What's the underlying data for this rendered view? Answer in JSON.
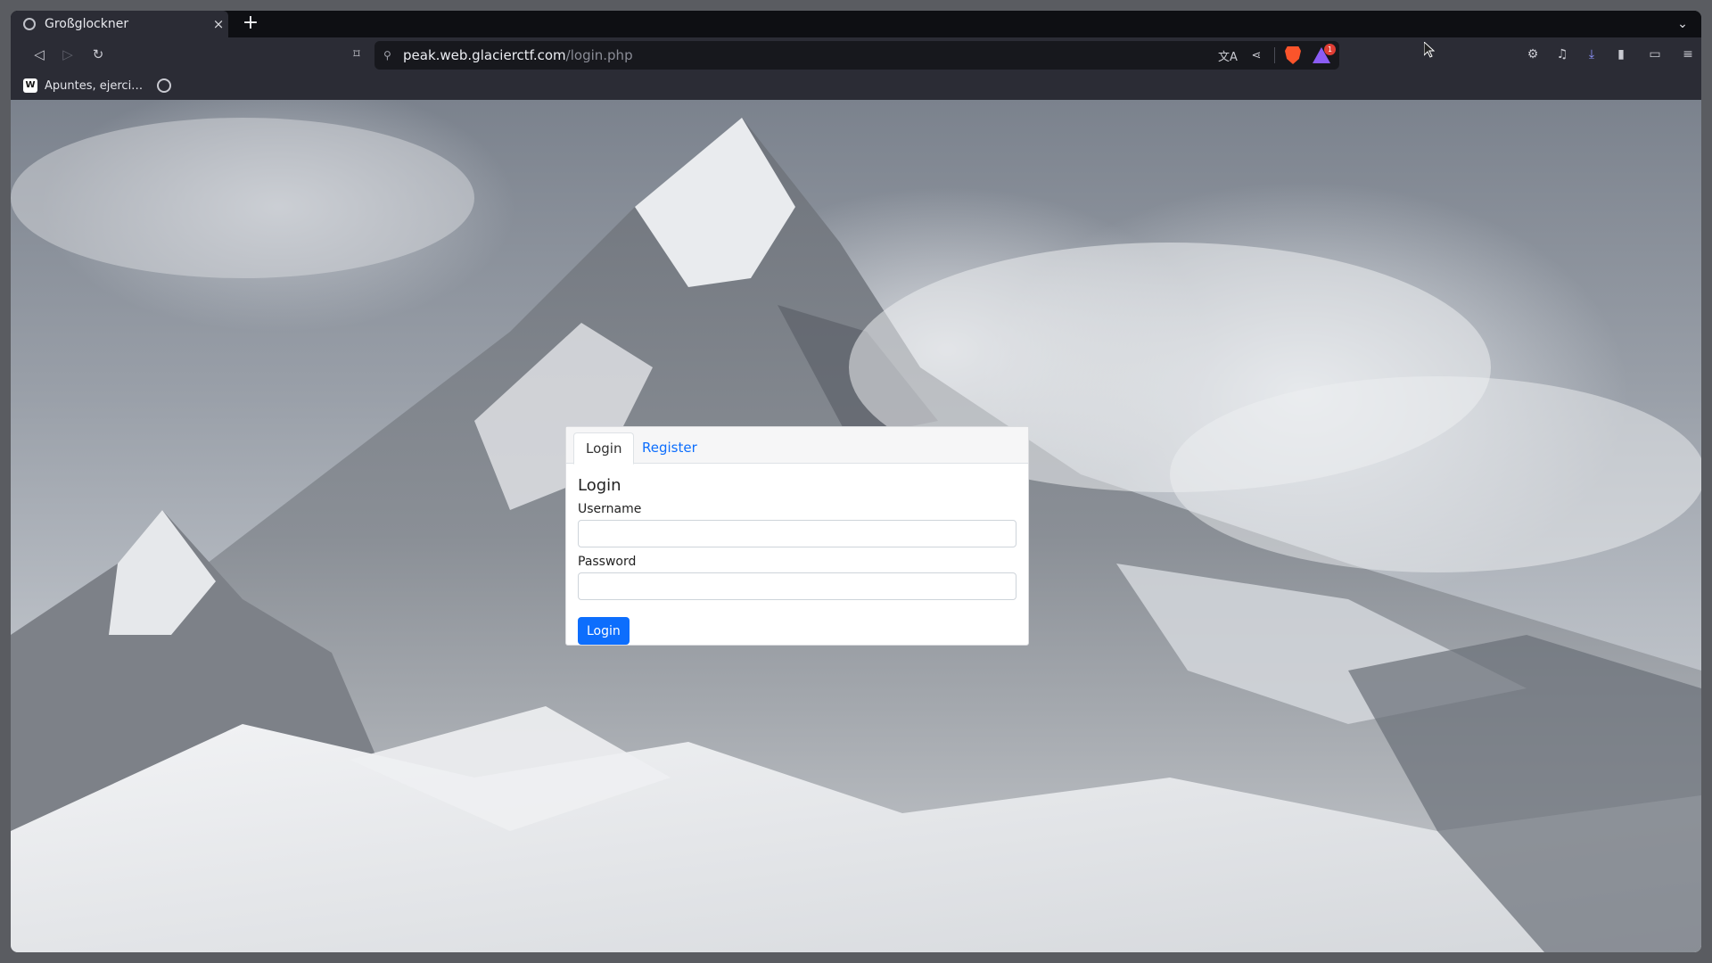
{
  "browser": {
    "tab_title": "Großglockner",
    "tab_close": "×",
    "new_tab": "+",
    "url_host": "peak.web.glacierctf.com",
    "url_path": "/login.php",
    "rewards_badge": "1",
    "bookmark_label": "Apuntes, ejerci…",
    "bookmark_favicon": "W"
  },
  "icons": {
    "back": "◁",
    "forward": "▷",
    "reload": "↻",
    "bookmark": "⌑",
    "translate": "文A",
    "share": "⋖",
    "extensions": "⚙",
    "music": "♫",
    "download": "⤓",
    "sidebar": "▮",
    "wallet": "▭",
    "menu": "≡",
    "tab_list": "⌄",
    "site_info": "⚲"
  },
  "page": {
    "tabs": [
      {
        "label": "Login",
        "active": true
      },
      {
        "label": "Register",
        "active": false
      }
    ],
    "heading": "Login",
    "username_label": "Username",
    "username_value": "",
    "password_label": "Password",
    "password_value": "",
    "submit_label": "Login"
  },
  "colors": {
    "primary": "#0d6efd",
    "browser_chrome": "#2b2c35",
    "brave_orange": "#fb542b"
  }
}
